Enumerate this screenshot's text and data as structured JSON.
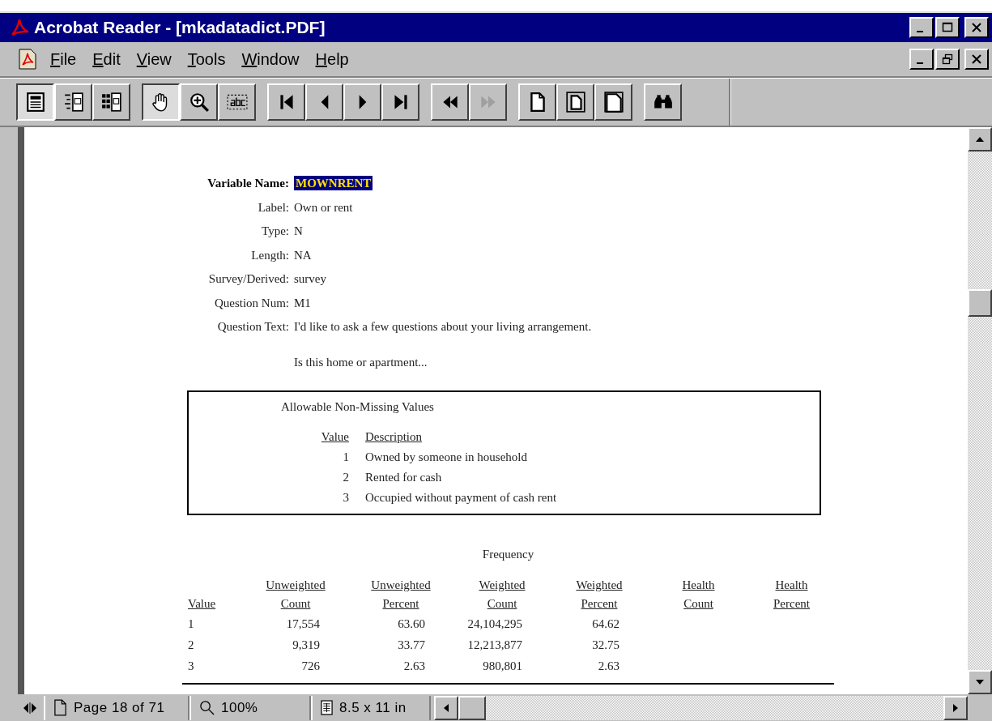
{
  "window": {
    "title": "Acrobat Reader - [mkadatadict.PDF]"
  },
  "menu": [
    "File",
    "Edit",
    "View",
    "Tools",
    "Window",
    "Help"
  ],
  "toolbar": [
    {
      "buttons": [
        {
          "kind": "pageonly",
          "selected": true,
          "disabled": false
        },
        {
          "kind": "bookmarks",
          "selected": false,
          "disabled": false
        },
        {
          "kind": "thumbnails",
          "selected": false,
          "disabled": false
        }
      ]
    },
    {
      "buttons": [
        {
          "kind": "hand",
          "selected": true,
          "disabled": false
        },
        {
          "kind": "zoom",
          "selected": false,
          "disabled": false
        },
        {
          "kind": "text",
          "selected": false,
          "disabled": false
        }
      ]
    },
    {
      "buttons": [
        {
          "kind": "first",
          "selected": false,
          "disabled": false
        },
        {
          "kind": "prev",
          "selected": false,
          "disabled": false
        },
        {
          "kind": "next",
          "selected": false,
          "disabled": false
        },
        {
          "kind": "last",
          "selected": false,
          "disabled": false
        }
      ]
    },
    {
      "buttons": [
        {
          "kind": "back",
          "selected": false,
          "disabled": false
        },
        {
          "kind": "forward",
          "selected": false,
          "disabled": true
        }
      ]
    },
    {
      "buttons": [
        {
          "kind": "actual",
          "selected": false,
          "disabled": false
        },
        {
          "kind": "fitpage",
          "selected": false,
          "disabled": false
        },
        {
          "kind": "fitwidth",
          "selected": false,
          "disabled": false
        }
      ]
    },
    {
      "buttons": [
        {
          "kind": "find",
          "selected": false,
          "disabled": false
        }
      ]
    }
  ],
  "document": {
    "variable_name": {
      "label": "Variable Name:",
      "value": "MOWNRENT",
      "selected": true
    },
    "fields": [
      {
        "label": "Label:",
        "value": "Own or rent"
      },
      {
        "label": "Type:",
        "value": "N"
      },
      {
        "label": "Length:",
        "value": "NA"
      },
      {
        "label": "Survey/Derived:",
        "value": "survey"
      },
      {
        "label": "Question Num:",
        "value": "M1"
      },
      {
        "label": "Question Text:",
        "value": "I'd like to ask a few questions about your living arrangement."
      }
    ],
    "question_continued": "Is this home or apartment...",
    "allowable_values": {
      "title": "Allowable Non-Missing Values",
      "columns": [
        "Value",
        "Description"
      ],
      "rows": [
        [
          "1",
          "Owned by someone in household"
        ],
        [
          "2",
          "Rented for cash"
        ],
        [
          "3",
          "Occupied without payment of cash rent"
        ]
      ]
    },
    "frequency": {
      "title": "Frequency",
      "columns": [
        {
          "bottom": "Value"
        },
        {
          "top": "Unweighted",
          "bottom": "Count"
        },
        {
          "top": "Unweighted",
          "bottom": "Percent"
        },
        {
          "top": "Weighted",
          "bottom": "Count"
        },
        {
          "top": "Weighted",
          "bottom": "Percent"
        },
        {
          "top": "Health",
          "bottom": "Count"
        },
        {
          "top": "Health",
          "bottom": "Percent"
        }
      ],
      "rows": [
        [
          "1",
          "17,554",
          "63.60",
          "24,104,295",
          "64.62"
        ],
        [
          "2",
          "9,319",
          "33.77",
          "12,213,877",
          "32.75"
        ],
        [
          "3",
          "726",
          "2.63",
          "980,801",
          "2.63"
        ]
      ]
    }
  },
  "status_bar": {
    "page": "Page 18 of 71",
    "zoom": "100%",
    "page_size": "8.5 x 11 in"
  }
}
